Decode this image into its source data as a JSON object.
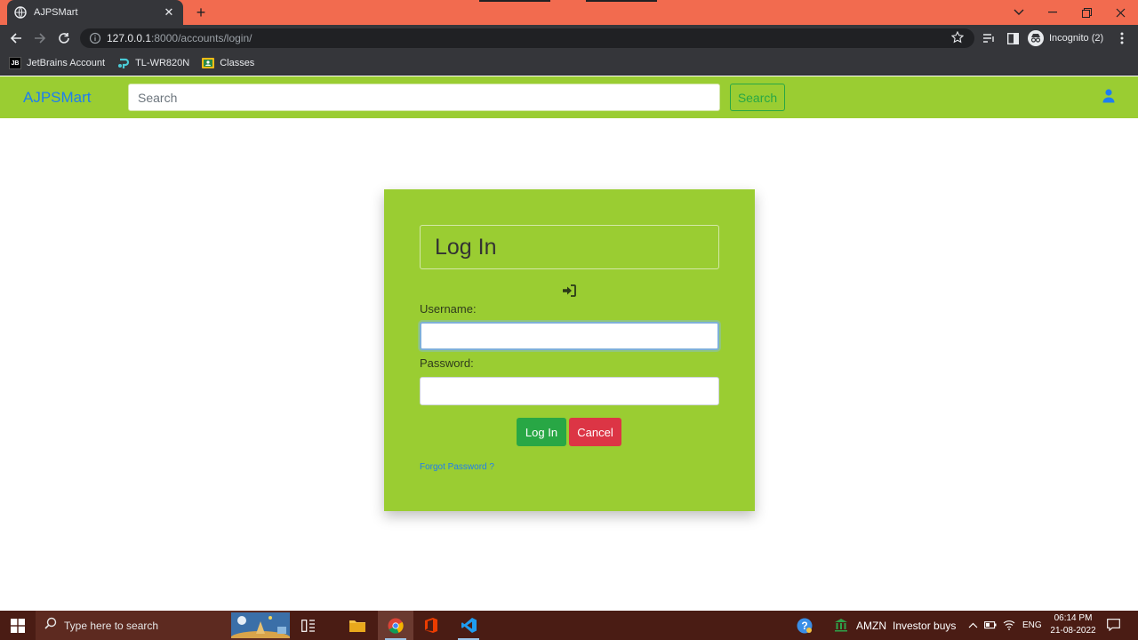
{
  "browser": {
    "tab_title": "AJPSMart",
    "url_host": "127.0.0.1",
    "url_path": ":8000/accounts/login/",
    "profile_label": "Incognito (2)",
    "bookmarks": [
      {
        "label": "JetBrains Account",
        "icon": "jetbrains-icon"
      },
      {
        "label": "TL-WR820N",
        "icon": "tplink-icon"
      },
      {
        "label": "Classes",
        "icon": "classroom-icon"
      }
    ]
  },
  "site": {
    "brand": "AJPSMart",
    "search_placeholder": "Search",
    "search_button": "Search",
    "accent_color": "#9acd32"
  },
  "login": {
    "title": "Log In",
    "username_label": "Username:",
    "username_value": "",
    "password_label": "Password:",
    "password_value": "",
    "login_button": "Log In",
    "cancel_button": "Cancel",
    "forgot_link": "Forgot Password ?"
  },
  "taskbar": {
    "search_placeholder": "Type here to search",
    "news_ticker": "AMZN",
    "news_text": "Investor buys",
    "language": "ENG",
    "time": "06:14 PM",
    "date": "21-08-2022"
  }
}
